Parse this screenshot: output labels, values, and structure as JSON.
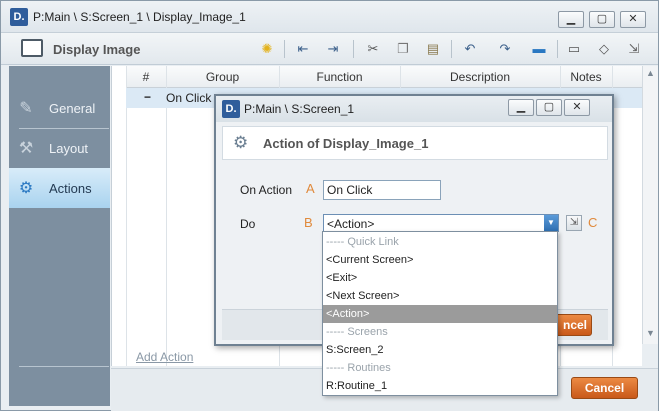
{
  "window": {
    "logo": "D.",
    "title": "P:Main \\ S:Screen_1 \\ Display_Image_1",
    "minimize": "▁",
    "maximize": "▢",
    "close": "✕"
  },
  "toolbar": {
    "title": "Display Image",
    "icons": [
      "lightbulb-icon",
      "outdent-icon",
      "indent-icon",
      "cut-icon",
      "copy-icon",
      "paste-icon",
      "undo-icon",
      "redo-icon",
      "comment-icon",
      "speech-icon",
      "tag-icon",
      "export-icon"
    ]
  },
  "nav": {
    "items": [
      {
        "label": "General",
        "icon": "pencil-icon"
      },
      {
        "label": "Layout",
        "icon": "tools-icon"
      },
      {
        "label": "Actions",
        "icon": "gears-icon"
      }
    ]
  },
  "table": {
    "headers": [
      "#",
      "Group",
      "Function",
      "Description",
      "Notes"
    ],
    "row_toggle": "−",
    "row_group": "On Click"
  },
  "add_action": "Add Action",
  "cancel": "Cancel",
  "dialog": {
    "logo": "D.",
    "title": "P:Main \\ S:Screen_1",
    "heading": "Action of Display_Image_1",
    "on_action_label": "On Action",
    "on_action_letter": "A",
    "on_action_value": "On Click",
    "do_label": "Do",
    "do_letter": "B",
    "do_value": "<Action>",
    "side_letter": "C",
    "cancel_partial": "ncel"
  },
  "dropdown": {
    "options": [
      {
        "text": "----- Quick Link",
        "type": "group"
      },
      {
        "text": "<Current Screen>",
        "type": "item"
      },
      {
        "text": "<Exit>",
        "type": "item"
      },
      {
        "text": "<Next Screen>",
        "type": "item"
      },
      {
        "text": "<Action>",
        "type": "selected"
      },
      {
        "text": "----- Screens",
        "type": "group"
      },
      {
        "text": "S:Screen_2",
        "type": "item"
      },
      {
        "text": "----- Routines",
        "type": "group"
      },
      {
        "text": "R:Routine_1",
        "type": "item"
      }
    ]
  }
}
